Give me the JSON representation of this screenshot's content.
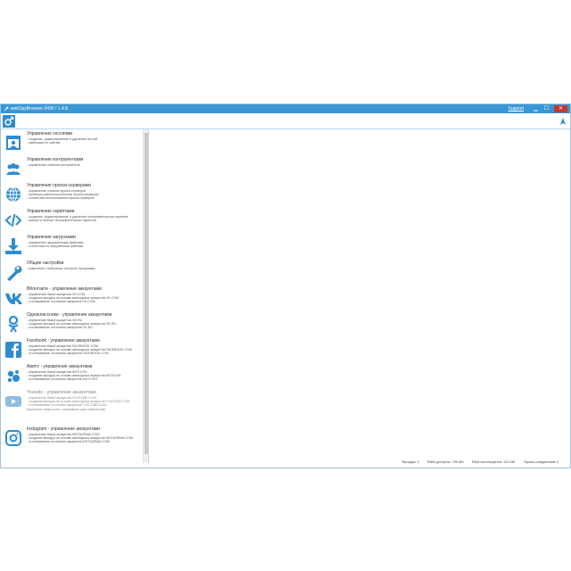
{
  "titlebar": {
    "title": "webSpyBrowser 0490 / 1.4.8",
    "support_label": "Support",
    "min_glyph": "▁",
    "max_glyph": "☐",
    "close_glyph": "✕"
  },
  "colors": {
    "accent": "#3a97d4",
    "icon": "#2e8cd0",
    "close": "#c7372f"
  },
  "sidebar": {
    "items": [
      {
        "icon": "browser-window-icon",
        "title": "Управление сессиями",
        "desc": "- создание, редактирование и удаление сессий\n- навигация по сайтам"
      },
      {
        "icon": "users-icon",
        "title": "Управление контрагентами",
        "desc": "- управление списком контрагентов"
      },
      {
        "icon": "globe-icon",
        "title": "Управление прокси-серверами",
        "desc": "- управление списком прокси-серверов\n- проверка работоспособности прокси-серверов\n- статистика использования прокси-серверов"
      },
      {
        "icon": "code-icon",
        "title": "Управление скриптами",
        "desc": "- создание, редактирование и удаление пользовательских скриптов\n- импорт и экспорт пользовательских скриптов"
      },
      {
        "icon": "download-icon",
        "title": "Управление загрузками",
        "desc": "- управление загруженными файлами\n- статистика по загруженным файлам"
      },
      {
        "icon": "wrench-icon",
        "title": "Общие настройки",
        "desc": "- изменение глобальных настроек программы"
      },
      {
        "icon": "vk-icon",
        "title": "ВКонтакте - управление аккаунтами",
        "desc": "- управление базой аккаунтов VK.COM\n- создание вкладок на основе имеющихся аккаунтов VK.COM\n- отслеживание состояния аккаунтов VK.COM"
      },
      {
        "icon": "odnoklassniki-icon",
        "title": "Одноклассники - управление аккаунтами",
        "desc": "- управление базой аккаунтов OK.RU\n- создание вкладок на основе имеющихся аккаунтов OK.RU\n- отслеживание состояния аккаунтов OK.RU"
      },
      {
        "icon": "facebook-icon",
        "title": "Facebook - управление аккаунтами",
        "desc": "- управление базой аккаунтов FACEBOOK.COM\n- создание вкладок на основе имеющихся аккаунтов FACEBOOK.COM\n- отслеживание состояния аккаунтов FACEBOOK.COM"
      },
      {
        "icon": "avito-icon",
        "title": "Авито - управление аккаунтами",
        "desc": "- управление базой аккаунтов AVITO.RU\n- создание вкладок на основе имеющихся аккаунтов AVITO.RU\n- отслеживание состояния аккаунтов AVITO.RU"
      },
      {
        "icon": "youtube-icon",
        "title": "Youtube - управление аккаунтами",
        "muted": true,
        "desc": "- управление базой аккаунтов YOUTUBE.COM\n- создание вкладок на основе имеющихся аккаунтов YOUTUBE.COM\n- отслеживание состояния аккаунтов YOUTUBE.COM\n(временно недоступно, принимаем идеи изменений)"
      },
      {
        "icon": "instagram-icon",
        "title": "Instagram - управление аккаунтами",
        "desc": "- управление базой аккаунтов INSTAGRAM.COM\n- создание вкладок на основе имеющихся аккаунтов INSTAGRAM.COM\n- отслеживание состояния аккаунтов INSTAGRAM.COM"
      }
    ]
  },
  "statusbar": {
    "tabs": "Вкладок: 0",
    "ram_available": "RAM доступно: 700 Mб",
    "ram_used": "RAM используется: 122 Mб",
    "proxy_connections": "Прокси-соединений: 0"
  }
}
